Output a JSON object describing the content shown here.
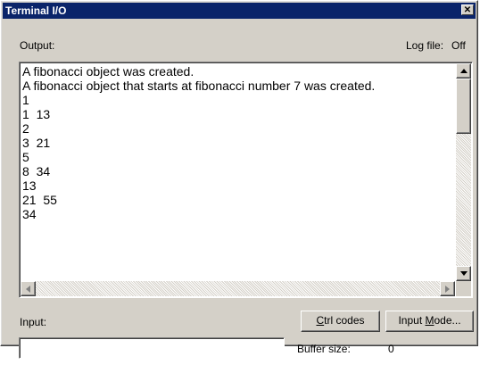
{
  "window": {
    "title": "Terminal I/O",
    "close_glyph": "✕"
  },
  "output": {
    "label": "Output:",
    "log_file_label": "Log file:",
    "log_file_value": "Off",
    "lines": [
      "A fibonacci object was created.",
      "A fibonacci object that starts at fibonacci number 7 was created.",
      "1",
      "1  13",
      "2",
      "3  21",
      "5",
      "8  34",
      "13",
      "21  55",
      "34"
    ]
  },
  "input": {
    "label": "Input:",
    "value": "",
    "ctrl_codes_prefix": "C",
    "ctrl_codes_rest": "trl codes",
    "input_mode_prefix": "Input ",
    "input_mode_mnemonic": "M",
    "input_mode_rest": "ode...",
    "buffer_size_label": "Buffer size:",
    "buffer_size_value": "0"
  },
  "icons": {
    "up": "arrow-up-icon",
    "down": "arrow-down-icon",
    "left": "arrow-left-icon",
    "right": "arrow-right-icon",
    "close": "close-icon"
  },
  "colors": {
    "titlebar": "#0a246a",
    "dialog": "#d4d0c8"
  }
}
